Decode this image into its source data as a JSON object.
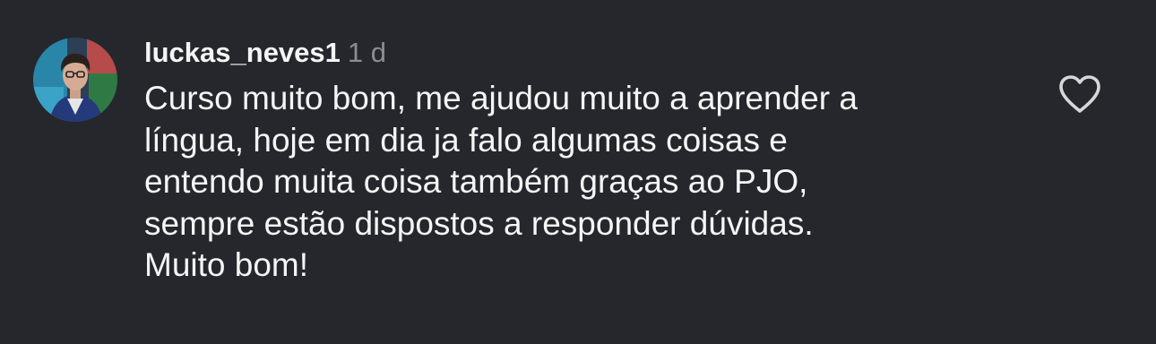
{
  "comment": {
    "username": "luckas_neves1",
    "time": "1 d",
    "text_lines": [
      "Curso muito bom, me ajudou muito a aprender a",
      "língua, hoje em dia ja falo algumas coisas e",
      "entendo muita coisa também graças ao PJO,",
      "sempre estão dispostos a responder dúvidas.",
      "Muito bom!"
    ]
  },
  "icons": {
    "avatar": "profile-photo",
    "like": "heart-outline-icon"
  },
  "colors": {
    "background": "#25272c",
    "text": "#f5f5f5",
    "muted": "#8b8d92"
  }
}
